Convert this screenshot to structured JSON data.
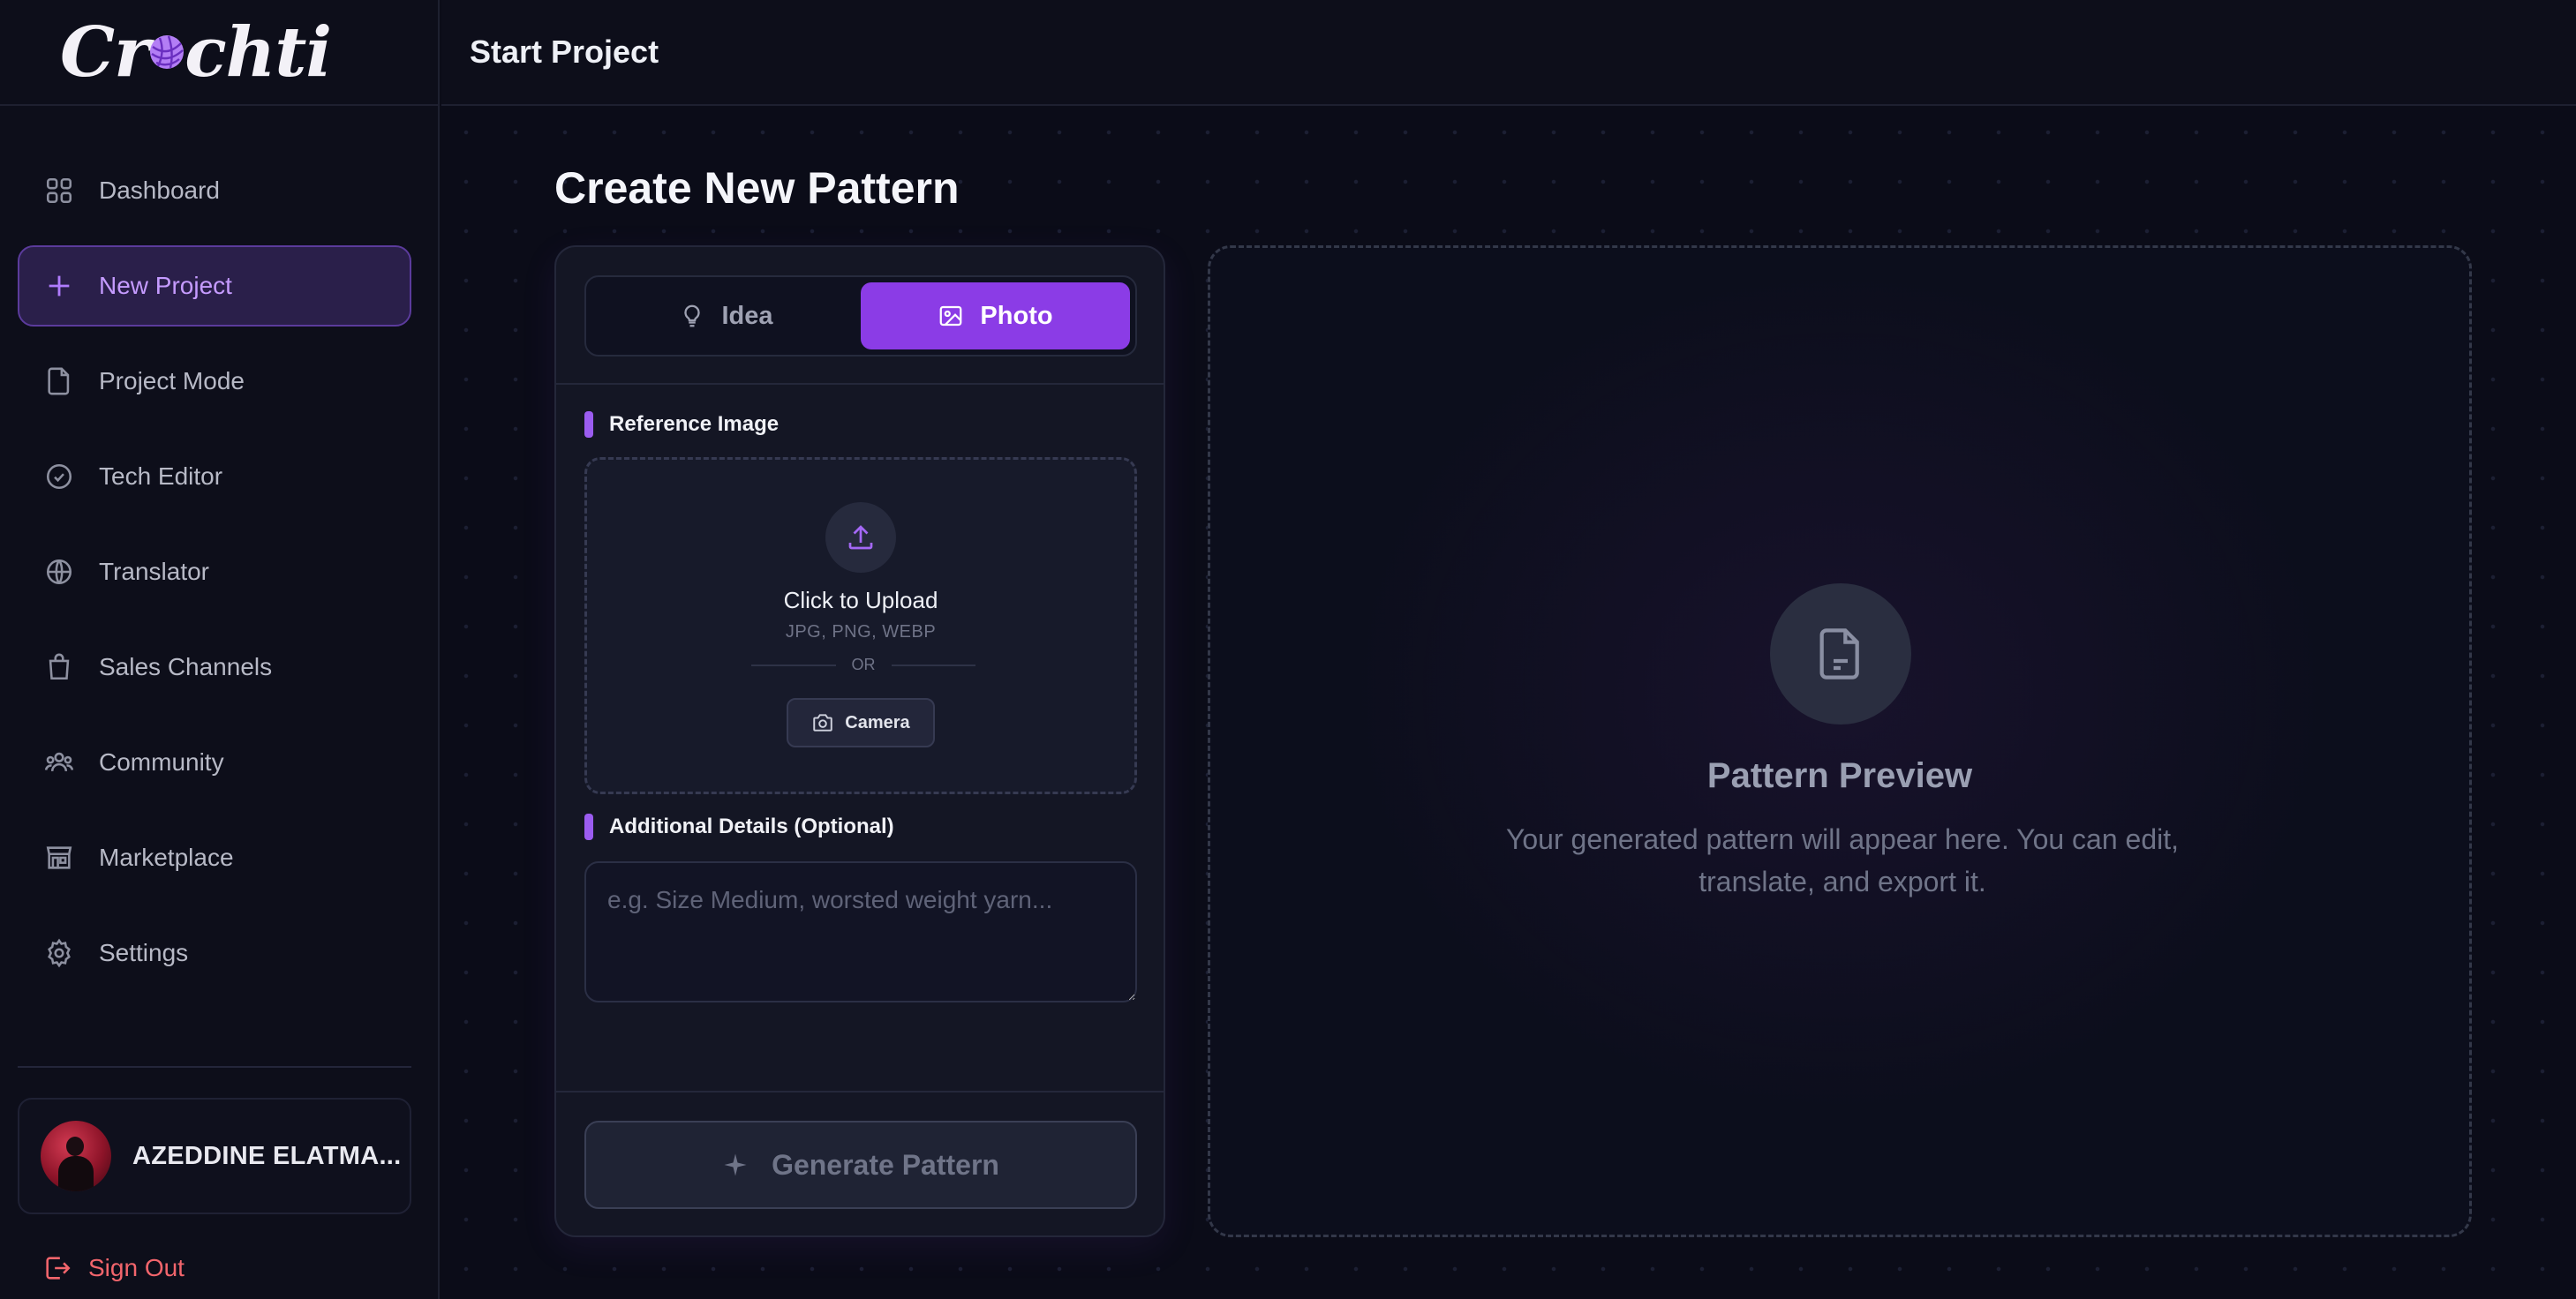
{
  "brand": {
    "name": "Crochti"
  },
  "topbar": {
    "title": "Start Project"
  },
  "sidebar": {
    "items": [
      {
        "label": "Dashboard",
        "icon": "grid-icon",
        "active": false
      },
      {
        "label": "New Project",
        "icon": "plus-icon",
        "active": true
      },
      {
        "label": "Project Mode",
        "icon": "file-icon",
        "active": false
      },
      {
        "label": "Tech Editor",
        "icon": "check-circle-icon",
        "active": false
      },
      {
        "label": "Translator",
        "icon": "globe-icon",
        "active": false
      },
      {
        "label": "Sales Channels",
        "icon": "shopping-bag-icon",
        "active": false
      },
      {
        "label": "Community",
        "icon": "users-icon",
        "active": false
      },
      {
        "label": "Marketplace",
        "icon": "store-icon",
        "active": false
      },
      {
        "label": "Settings",
        "icon": "gear-icon",
        "active": false
      }
    ],
    "user": {
      "name": "AZEDDINE ELATMA..."
    },
    "signout_label": "Sign Out"
  },
  "page": {
    "title": "Create New Pattern"
  },
  "form": {
    "tabs": [
      {
        "label": "Idea",
        "icon": "lightbulb-icon",
        "active": false
      },
      {
        "label": "Photo",
        "icon": "image-icon",
        "active": true
      }
    ],
    "reference_label": "Reference Image",
    "upload": {
      "title": "Click to Upload",
      "formats": "JPG, PNG, WEBP",
      "or": "OR",
      "camera_label": "Camera"
    },
    "details_label": "Additional Details (Optional)",
    "details_placeholder": "e.g. Size Medium, worsted weight yarn...",
    "details_value": "",
    "generate_label": "Generate Pattern"
  },
  "preview": {
    "title": "Pattern Preview",
    "description": "Your generated pattern will appear here. You can edit, translate, and export it."
  },
  "colors": {
    "accent": "#8b3ce6",
    "accent_light": "#c59bff",
    "danger": "#f2656c",
    "background": "#0b0c18"
  }
}
